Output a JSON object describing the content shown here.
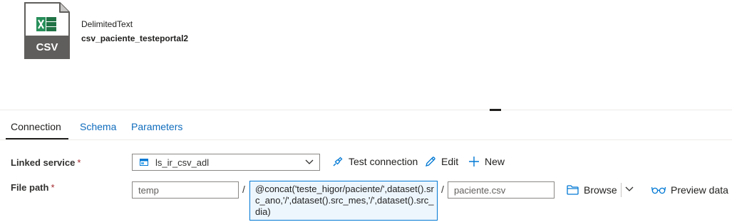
{
  "dataset": {
    "icon": "csv-file-icon",
    "icon_label": "CSV",
    "type": "DelimitedText",
    "name": "csv_paciente_testeportal2"
  },
  "tabs": [
    {
      "label": "Connection",
      "active": true
    },
    {
      "label": "Schema",
      "active": false
    },
    {
      "label": "Parameters",
      "active": false
    }
  ],
  "linked_service": {
    "label": "Linked service",
    "required_marker": "*",
    "selected": "ls_ir_csv_adl",
    "test_connection_label": "Test connection",
    "edit_label": "Edit",
    "new_label": "New"
  },
  "file_path": {
    "label": "File path",
    "required_marker": "*",
    "container_placeholder": "temp",
    "separator": "/",
    "directory_expression": "@concat('teste_higor/paciente/',dataset().src_ano,'/',dataset().src_mes,'/',dataset().src_dia)",
    "file_placeholder": "paciente.csv",
    "browse_label": "Browse",
    "preview_label": "Preview data"
  },
  "colors": {
    "accent": "#0078d4",
    "link": "#0f6cbd",
    "excel_green": "#217346",
    "required": "#a4262c"
  }
}
